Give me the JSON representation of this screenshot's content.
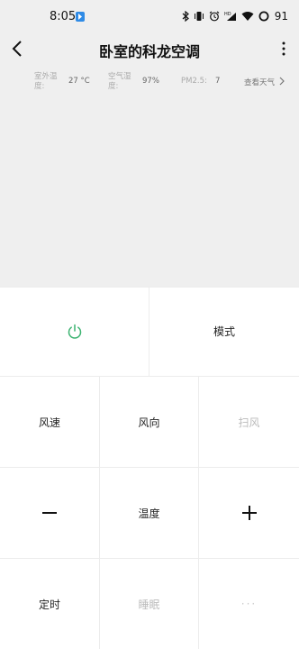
{
  "status_bar": {
    "time": "8:05",
    "battery": "91"
  },
  "header": {
    "title": "卧室的科龙空调"
  },
  "info": {
    "outdoor_temp_label": "室外温度:",
    "outdoor_temp_value": "27 °C",
    "humidity_label": "空气湿度:",
    "humidity_value": "97%",
    "pm25_label": "PM2.5:",
    "pm25_value": "7",
    "weather_link": "查看天气"
  },
  "controls": {
    "mode": "模式",
    "fan_speed": "风速",
    "wind_direction": "风向",
    "swing": "扫风",
    "temperature": "温度",
    "timer": "定时",
    "sleep": "睡眠",
    "more": "···"
  },
  "colors": {
    "power_icon": "#3cb371",
    "disabled_text": "#bbbbbb"
  }
}
